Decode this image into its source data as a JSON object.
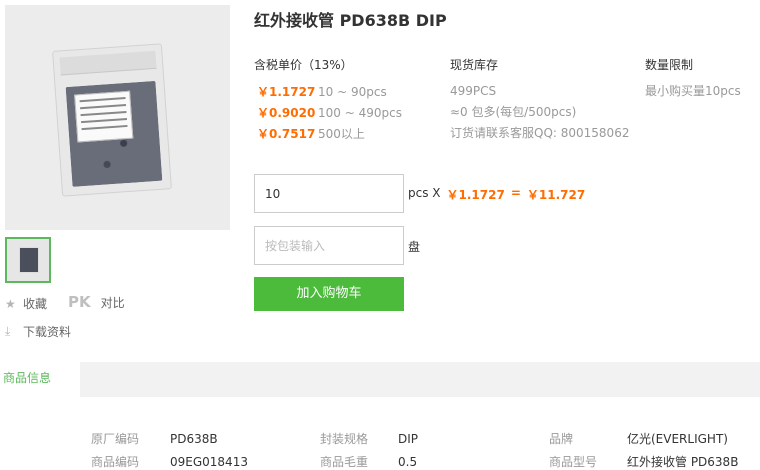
{
  "product": {
    "title": "红外接收管 PD638B DIP"
  },
  "pricing": {
    "header": "含税单价（13%）",
    "rows": [
      {
        "price": "￥1.1727",
        "range": "10 ~ 90pcs"
      },
      {
        "price": "￥0.9020",
        "range": "100 ~ 490pcs"
      },
      {
        "price": "￥0.7517",
        "range": "500以上"
      }
    ]
  },
  "stock": {
    "header": "现货库存",
    "lines": [
      "499PCS",
      "≈0 包多(每包/500pcs)",
      "订货请联系客服QQ: 800158062"
    ]
  },
  "limit": {
    "header": "数量限制",
    "text": "最小购买量10pcs"
  },
  "order": {
    "quantity": "10",
    "unit_label": "pcs X",
    "unit_price": "￥1.1727",
    "equals": "=",
    "total": "￥11.727",
    "pack_placeholder": "按包装输入",
    "pack_unit": "盘",
    "cart_label": "加入购物车"
  },
  "side": {
    "favorite": "收藏",
    "pk": "PK",
    "compare": "对比",
    "download": "下载资料"
  },
  "tabs": {
    "info": "商品信息"
  },
  "specs": [
    {
      "key": "原厂编码",
      "value": "PD638B"
    },
    {
      "key": "封装规格",
      "value": "DIP"
    },
    {
      "key": "品牌",
      "value": "亿光(EVERLIGHT)"
    },
    {
      "key": "商品编码",
      "value": "09EG018413"
    },
    {
      "key": "商品毛重",
      "value": "0.5"
    },
    {
      "key": "商品型号",
      "value": "红外接收管 PD638B DIP"
    }
  ],
  "colors": {
    "price": "#ff6c00",
    "button": "#4cbb3c",
    "tab_active": "#5cb85c"
  },
  "icons": [
    "star-icon",
    "download-icon"
  ]
}
